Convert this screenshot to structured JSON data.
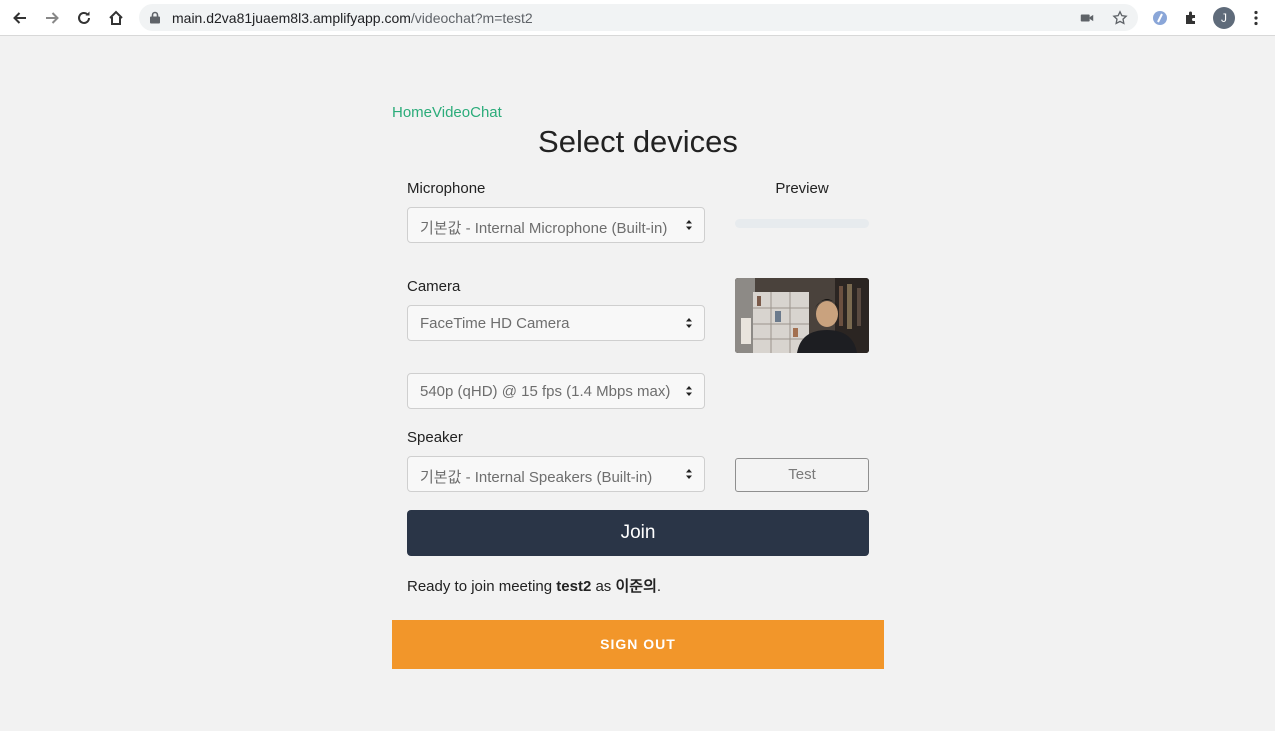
{
  "browser": {
    "url_host": "main.d2va81juaem8l3.amplifyapp.com",
    "url_path": "/videochat?m=test2",
    "profile_initial": "J"
  },
  "breadcrumb": {
    "home": "Home",
    "videochat": "VideoChat"
  },
  "page": {
    "title": "Select devices"
  },
  "microphone": {
    "label": "Microphone",
    "value": "기본값 - Internal Microphone (Built-in)"
  },
  "preview": {
    "label": "Preview"
  },
  "camera": {
    "label": "Camera",
    "value": "FaceTime HD Camera",
    "quality_value": "540p (qHD) @ 15 fps (1.4 Mbps max)"
  },
  "speaker": {
    "label": "Speaker",
    "value": "기본값 - Internal Speakers (Built-in)",
    "test_label": "Test"
  },
  "join": {
    "label": "Join"
  },
  "status": {
    "prefix": "Ready to join meeting ",
    "meeting": "test2",
    "middle": " as ",
    "user": "이준의",
    "suffix": "."
  },
  "signout": {
    "label": "SIGN OUT"
  },
  "colors": {
    "accent_green": "#2bac7a",
    "join_bg": "#2a3547",
    "signout_bg": "#f2962a",
    "page_bg": "#f2f2f2"
  }
}
